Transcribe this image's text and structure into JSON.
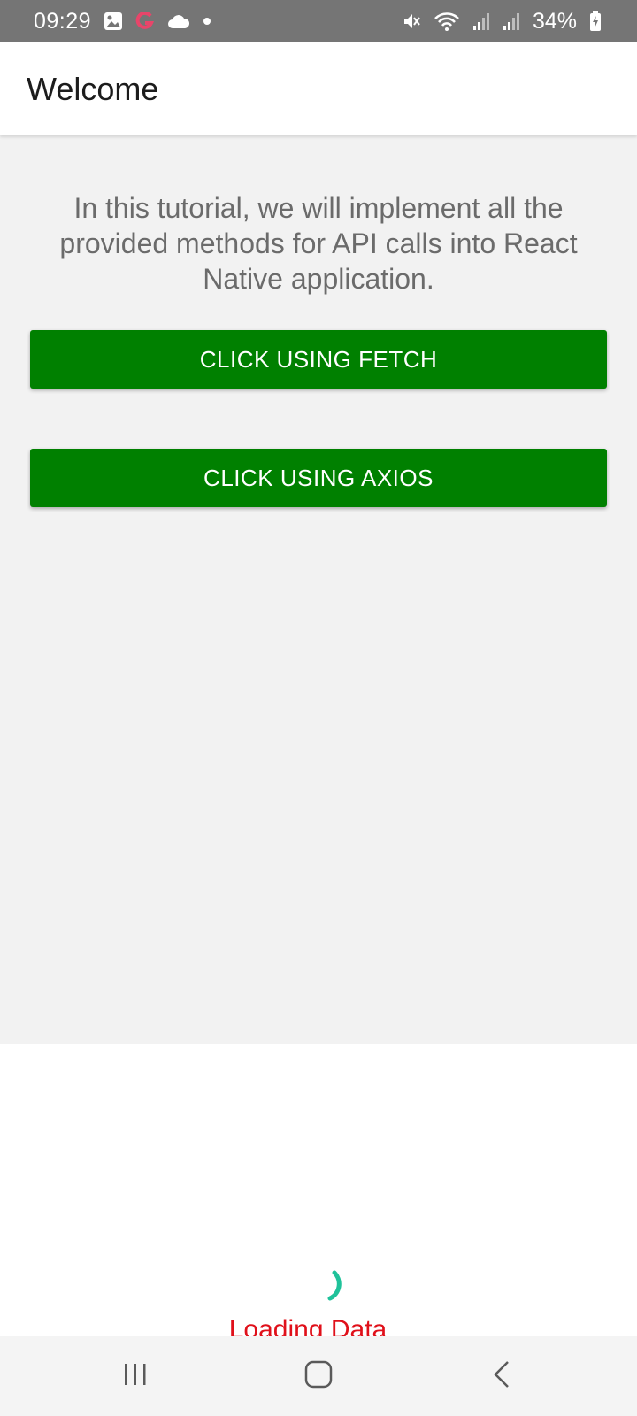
{
  "status_bar": {
    "time": "09:29",
    "battery_percent": "34%",
    "icons_left": [
      "gallery-icon",
      "app-notification-icon",
      "cloud-icon",
      "dot-icon"
    ],
    "icons_right": [
      "mute-icon",
      "wifi-icon",
      "signal-icon",
      "signal-icon",
      "battery-charging-icon"
    ],
    "color": "#757575"
  },
  "app_bar": {
    "title": "Welcome"
  },
  "main": {
    "intro": "In this tutorial, we will implement all the provided methods for API calls into React Native application.",
    "fetch_button_label": "CLICK USING FETCH",
    "axios_button_label": "CLICK USING AXIOS",
    "button_color": "#008000"
  },
  "loading": {
    "text": "Loading Data",
    "text_color": "#e0101a",
    "spinner_color": "#1fc29a"
  },
  "nav_bar": {
    "buttons": [
      "recents-icon",
      "home-icon",
      "back-icon"
    ]
  }
}
